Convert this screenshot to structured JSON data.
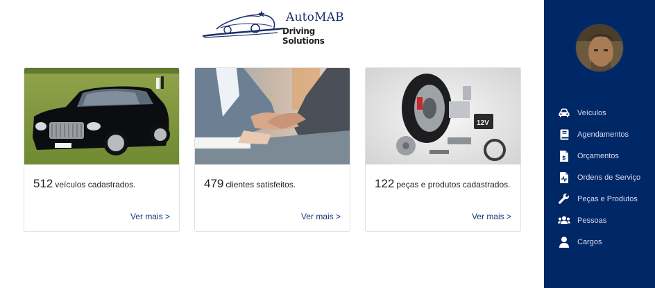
{
  "logo": {
    "brand": "AutoMAB",
    "tagline": "Driving Solutions"
  },
  "cards": [
    {
      "number": "512",
      "text": "veículos cadastrados.",
      "link": "Ver mais >"
    },
    {
      "number": "479",
      "text": "clientes satisfeitos.",
      "link": "Ver mais >"
    },
    {
      "number": "122",
      "text": "peças e produtos cadastrados.",
      "link": "Ver mais >"
    }
  ],
  "sidebar": {
    "items": [
      {
        "label": "Veículos",
        "icon": "car-icon"
      },
      {
        "label": "Agendamentos",
        "icon": "book-icon"
      },
      {
        "label": "Orçamentos",
        "icon": "invoice-dollar-icon"
      },
      {
        "label": "Ordens de Serviço",
        "icon": "file-medical-icon"
      },
      {
        "label": "Peças e Produtos",
        "icon": "wrench-icon"
      },
      {
        "label": "Pessoas",
        "icon": "users-icon"
      },
      {
        "label": "Cargos",
        "icon": "user-icon"
      }
    ]
  },
  "colors": {
    "sidebar": "#002766",
    "link": "#123a7a",
    "brand": "#1c2f6b"
  }
}
